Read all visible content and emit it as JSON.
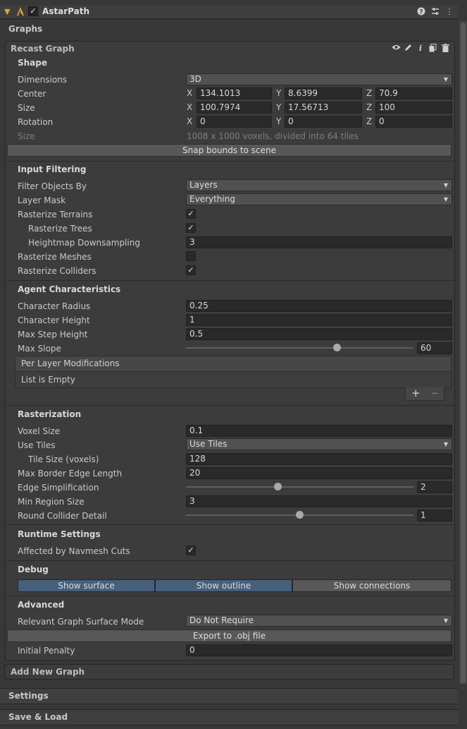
{
  "component": {
    "title": "AstarPath"
  },
  "graphs_label": "Graphs",
  "graph": {
    "title": "Recast Graph"
  },
  "shape": {
    "title": "Shape",
    "dimensions": {
      "label": "Dimensions",
      "value": "3D"
    },
    "center": {
      "label": "Center",
      "x": "134.1013",
      "y": "8.6399",
      "z": "70.9"
    },
    "size": {
      "label": "Size",
      "x": "100.7974",
      "y": "17.56713",
      "z": "100"
    },
    "rotation": {
      "label": "Rotation",
      "x": "0",
      "y": "0",
      "z": "0"
    },
    "size_info": {
      "label": "Size",
      "value": "1008 x 1000 voxels, divided into 64 tiles"
    },
    "snap_button": "Snap bounds to scene"
  },
  "axis": {
    "x": "X",
    "y": "Y",
    "z": "Z"
  },
  "input_filtering": {
    "title": "Input Filtering",
    "filter_objects_by": {
      "label": "Filter Objects By",
      "value": "Layers"
    },
    "layer_mask": {
      "label": "Layer Mask",
      "value": "Everything"
    },
    "rasterize_terrains": {
      "label": "Rasterize Terrains",
      "checked": true
    },
    "rasterize_trees": {
      "label": "Rasterize Trees",
      "checked": true
    },
    "heightmap_downsampling": {
      "label": "Heightmap Downsampling",
      "value": "3"
    },
    "rasterize_meshes": {
      "label": "Rasterize Meshes",
      "checked": false
    },
    "rasterize_colliders": {
      "label": "Rasterize Colliders",
      "checked": true
    }
  },
  "agent": {
    "title": "Agent Characteristics",
    "character_radius": {
      "label": "Character Radius",
      "value": "0.25"
    },
    "character_height": {
      "label": "Character Height",
      "value": "1"
    },
    "max_step_height": {
      "label": "Max Step Height",
      "value": "0.5"
    },
    "max_slope": {
      "label": "Max Slope",
      "value": "60"
    },
    "per_layer": {
      "label": "Per Layer Modifications",
      "empty": "List is Empty"
    }
  },
  "rasterization": {
    "title": "Rasterization",
    "voxel_size": {
      "label": "Voxel Size",
      "value": "0.1"
    },
    "use_tiles": {
      "label": "Use Tiles",
      "value": "Use Tiles"
    },
    "tile_size": {
      "label": "Tile Size (voxels)",
      "value": "128"
    },
    "max_border_edge": {
      "label": "Max Border Edge Length",
      "value": "20"
    },
    "edge_simplification": {
      "label": "Edge Simplification",
      "value": "2"
    },
    "min_region_size": {
      "label": "Min Region Size",
      "value": "3"
    },
    "round_collider_detail": {
      "label": "Round Collider Detail",
      "value": "1"
    }
  },
  "runtime": {
    "title": "Runtime Settings",
    "affected_by_cuts": {
      "label": "Affected by Navmesh Cuts",
      "checked": true
    }
  },
  "debug": {
    "title": "Debug",
    "buttons": [
      "Show surface",
      "Show outline",
      "Show connections"
    ]
  },
  "advanced": {
    "title": "Advanced",
    "surface_mode": {
      "label": "Relevant Graph Surface Mode",
      "value": "Do Not Require"
    },
    "export_button": "Export to .obj file",
    "initial_penalty": {
      "label": "Initial Penalty",
      "value": "0"
    }
  },
  "add_new_graph": "Add New Graph",
  "settings_label": "Settings",
  "save_load_label": "Save & Load",
  "check_glyph": "✓",
  "colors": {
    "accent": "#46607c",
    "orange": "#e8a030"
  }
}
